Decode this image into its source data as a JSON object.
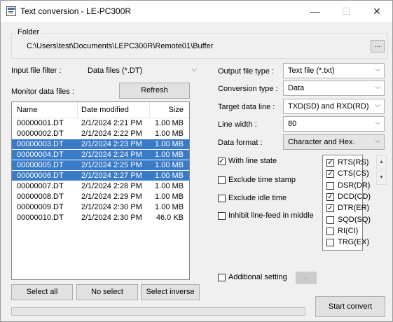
{
  "window": {
    "title": "Text conversion - LE-PC300R",
    "minimize": "—",
    "maximize": "☐",
    "close": "✕"
  },
  "folder": {
    "label": "Folder",
    "path": "C:\\Users\\test\\Documents\\LEPC300R\\Remote01\\Buffer",
    "browse_label": "..."
  },
  "input_filter": {
    "label": "Input file filter :",
    "value": "Data files (*.DT)"
  },
  "monitor": {
    "label": "Monitor data files :",
    "refresh_label": "Refresh"
  },
  "file_list": {
    "columns": [
      "Name",
      "Date modified",
      "Size"
    ],
    "rows": [
      {
        "name": "00000001.DT",
        "date": "2/1/2024 2:21 PM",
        "size": "1.00 MB",
        "selected": false
      },
      {
        "name": "00000002.DT",
        "date": "2/1/2024 2:22 PM",
        "size": "1.00 MB",
        "selected": false
      },
      {
        "name": "00000003.DT",
        "date": "2/1/2024 2:23 PM",
        "size": "1.00 MB",
        "selected": true
      },
      {
        "name": "00000004.DT",
        "date": "2/1/2024 2:24 PM",
        "size": "1.00 MB",
        "selected": true
      },
      {
        "name": "00000005.DT",
        "date": "2/1/2024 2:25 PM",
        "size": "1.00 MB",
        "selected": true
      },
      {
        "name": "00000006.DT",
        "date": "2/1/2024 2:27 PM",
        "size": "1.00 MB",
        "selected": true
      },
      {
        "name": "00000007.DT",
        "date": "2/1/2024 2:28 PM",
        "size": "1.00 MB",
        "selected": false
      },
      {
        "name": "00000008.DT",
        "date": "2/1/2024 2:29 PM",
        "size": "1.00 MB",
        "selected": false
      },
      {
        "name": "00000009.DT",
        "date": "2/1/2024 2:30 PM",
        "size": "1.00 MB",
        "selected": false
      },
      {
        "name": "00000010.DT",
        "date": "2/1/2024 2:30 PM",
        "size": "46.0 KB",
        "selected": false
      }
    ]
  },
  "selection_buttons": {
    "select_all": "Select all",
    "no_select": "No select",
    "select_inverse": "Select inverse"
  },
  "output_file_type": {
    "label": "Output file type :",
    "value": "Text file (*.txt)"
  },
  "conversion_type": {
    "label": "Conversion type :",
    "value": "Data"
  },
  "target_data_line": {
    "label": "Target data line :",
    "value": "TXD(SD) and RXD(RD)"
  },
  "line_width": {
    "label": "Line width :",
    "value": "80"
  },
  "data_format": {
    "label": "Data format :",
    "value": "Character and Hex."
  },
  "options": {
    "with_line_state": {
      "label": "With line state",
      "checked": true
    },
    "exclude_time_stamp": {
      "label": "Exclude time stamp",
      "checked": false
    },
    "exclude_idle_time": {
      "label": "Exclude idle time",
      "checked": false
    },
    "inhibit_line_feed": {
      "label": "Inhibit line-feed in middle",
      "checked": false
    }
  },
  "line_states": [
    {
      "label": "RTS(RS)",
      "checked": true
    },
    {
      "label": "CTS(CS)",
      "checked": true
    },
    {
      "label": "DSR(DR)",
      "checked": false
    },
    {
      "label": "DCD(CD)",
      "checked": true
    },
    {
      "label": "DTR(ER)",
      "checked": true
    },
    {
      "label": "SQD(SQ)",
      "checked": false
    },
    {
      "label": "RI(CI)",
      "checked": false
    },
    {
      "label": "TRG(EX)",
      "checked": false
    }
  ],
  "spin": {
    "up": "▲",
    "down": "▼"
  },
  "additional_setting": {
    "label": "Additional setting",
    "checked": false,
    "button_label": "..."
  },
  "start_convert_label": "Start convert",
  "progress": {
    "value": 0
  }
}
